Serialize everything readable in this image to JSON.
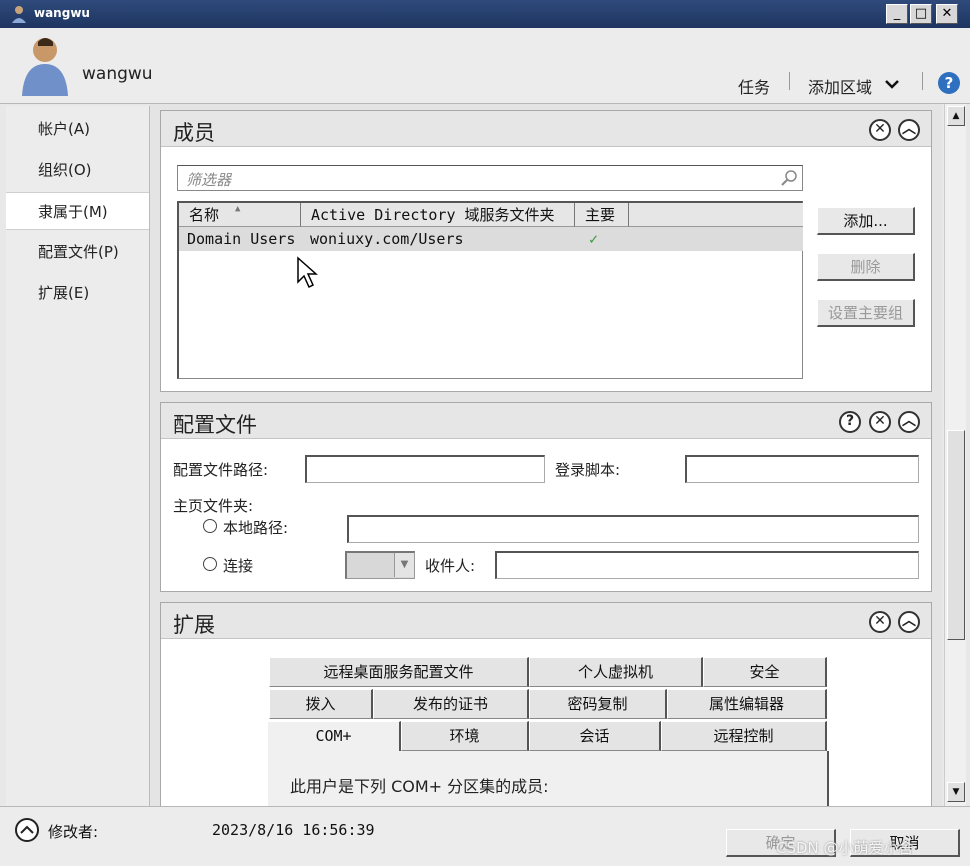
{
  "window": {
    "title": "wangwu"
  },
  "header": {
    "user_name": "wangwu",
    "tasks_label": "任务",
    "add_section_label": "添加区域",
    "help_glyph": "?"
  },
  "nav": {
    "items": [
      {
        "label": "帐户(A)"
      },
      {
        "label": "组织(O)"
      },
      {
        "label": "隶属于(M)"
      },
      {
        "label": "配置文件(P)"
      },
      {
        "label": "扩展(E)"
      }
    ],
    "active_index": 2
  },
  "members": {
    "title": "成员",
    "filter_placeholder": "筛选器",
    "columns": [
      "名称",
      "Active Directory 域服务文件夹",
      "主要"
    ],
    "rows": [
      {
        "name": "Domain Users",
        "folder": "woniuxy.com/Users",
        "primary": "✓"
      }
    ],
    "buttons": {
      "add": "添加...",
      "remove": "删除",
      "set_primary": "设置主要组"
    }
  },
  "profile": {
    "title": "配置文件",
    "profile_path_label": "配置文件路径:",
    "profile_path_value": "",
    "logon_script_label": "登录脚本:",
    "logon_script_value": "",
    "home_folder_label": "主页文件夹:",
    "local_path_label": "本地路径:",
    "local_path_value": "",
    "connect_label": "连接",
    "connect_drive_value": "",
    "to_label": "收件人:",
    "to_value": ""
  },
  "extensions": {
    "title": "扩展",
    "tab_rows": [
      [
        "远程桌面服务配置文件",
        "个人虚拟机",
        "安全"
      ],
      [
        "拨入",
        "发布的证书",
        "密码复制",
        "属性编辑器"
      ],
      [
        "COM+",
        "环境",
        "会话",
        "远程控制"
      ]
    ],
    "active_tab": "COM+",
    "panel_text": "此用户是下列 COM+ 分区集的成员:"
  },
  "footer": {
    "modified_by_label": "修改者:",
    "modified_time": "2023/8/16 16:56:39",
    "ok_label": "确定",
    "cancel_label": "取消",
    "watermark": "CSDN @小萌爱小舍"
  },
  "colors": {
    "titlebar": "#1d3560",
    "help_icon": "#2f6fbf",
    "check": "#3a9a3a",
    "row_selected": "#dcdcdc"
  }
}
